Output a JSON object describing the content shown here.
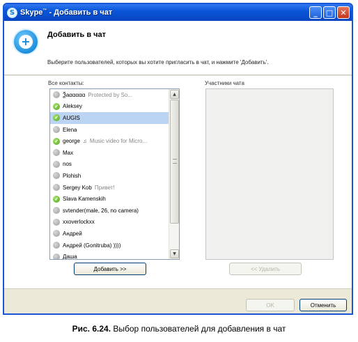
{
  "window": {
    "logo_glyph": "S",
    "title": "Skype",
    "title_mark": "™",
    "title_suffix": " - Добавить в чат",
    "minimize_glyph": "_",
    "maximize_glyph": "□",
    "close_glyph": "✕"
  },
  "header": {
    "icon": "add-chat-icon",
    "title": "Добавить в чат",
    "description": "Выберите пользователей, которых вы хотите пригласить в чат, и нажмите 'Добавить'."
  },
  "contacts": {
    "label": "Все контакты:",
    "items": [
      {
        "name": "Ѯаααααα",
        "mood": "Protected by So...",
        "status": "offline",
        "selected": false
      },
      {
        "name": "Aleksey",
        "mood": "",
        "status": "online",
        "selected": false
      },
      {
        "name": "AUGIS",
        "mood": "",
        "status": "online",
        "selected": true
      },
      {
        "name": "Elena",
        "mood": "",
        "status": "offline",
        "selected": false
      },
      {
        "name": "george",
        "mood": "Music video for Micro...",
        "status": "online",
        "selected": false,
        "note": true
      },
      {
        "name": "Max",
        "mood": "",
        "status": "offline",
        "selected": false
      },
      {
        "name": "nos",
        "mood": "",
        "status": "offline",
        "selected": false
      },
      {
        "name": "Plohish",
        "mood": "",
        "status": "offline",
        "selected": false
      },
      {
        "name": "Sergey Kob",
        "mood": "Привет!",
        "status": "offline",
        "selected": false
      },
      {
        "name": "Slava Kamenskih",
        "mood": "",
        "status": "online",
        "selected": false
      },
      {
        "name": "svtender(male, 26, no camera)",
        "mood": "",
        "status": "offline",
        "selected": false
      },
      {
        "name": "xxoverlockxx",
        "mood": "",
        "status": "offline",
        "selected": false
      },
      {
        "name": "Андрей",
        "mood": "",
        "status": "offline",
        "selected": false
      },
      {
        "name": "Андрей (Gonitruba) ))))",
        "mood": "",
        "status": "offline",
        "selected": false
      },
      {
        "name": "Даша",
        "mood": "",
        "status": "offline",
        "selected": false
      }
    ]
  },
  "members": {
    "label": "Участники чата"
  },
  "buttons": {
    "add": "Добавить >>",
    "remove": "<< Удалить",
    "ok": "OK",
    "cancel": "Отменить"
  },
  "caption": {
    "prefix": "Рис. 6.24.",
    "text": " Выбор пользователей для добавления в чат"
  },
  "colors": {
    "titlebar": "#0a56d8",
    "selection": "#bcd4f4",
    "online": "#4da61f",
    "offline": "#9a9a9a"
  }
}
